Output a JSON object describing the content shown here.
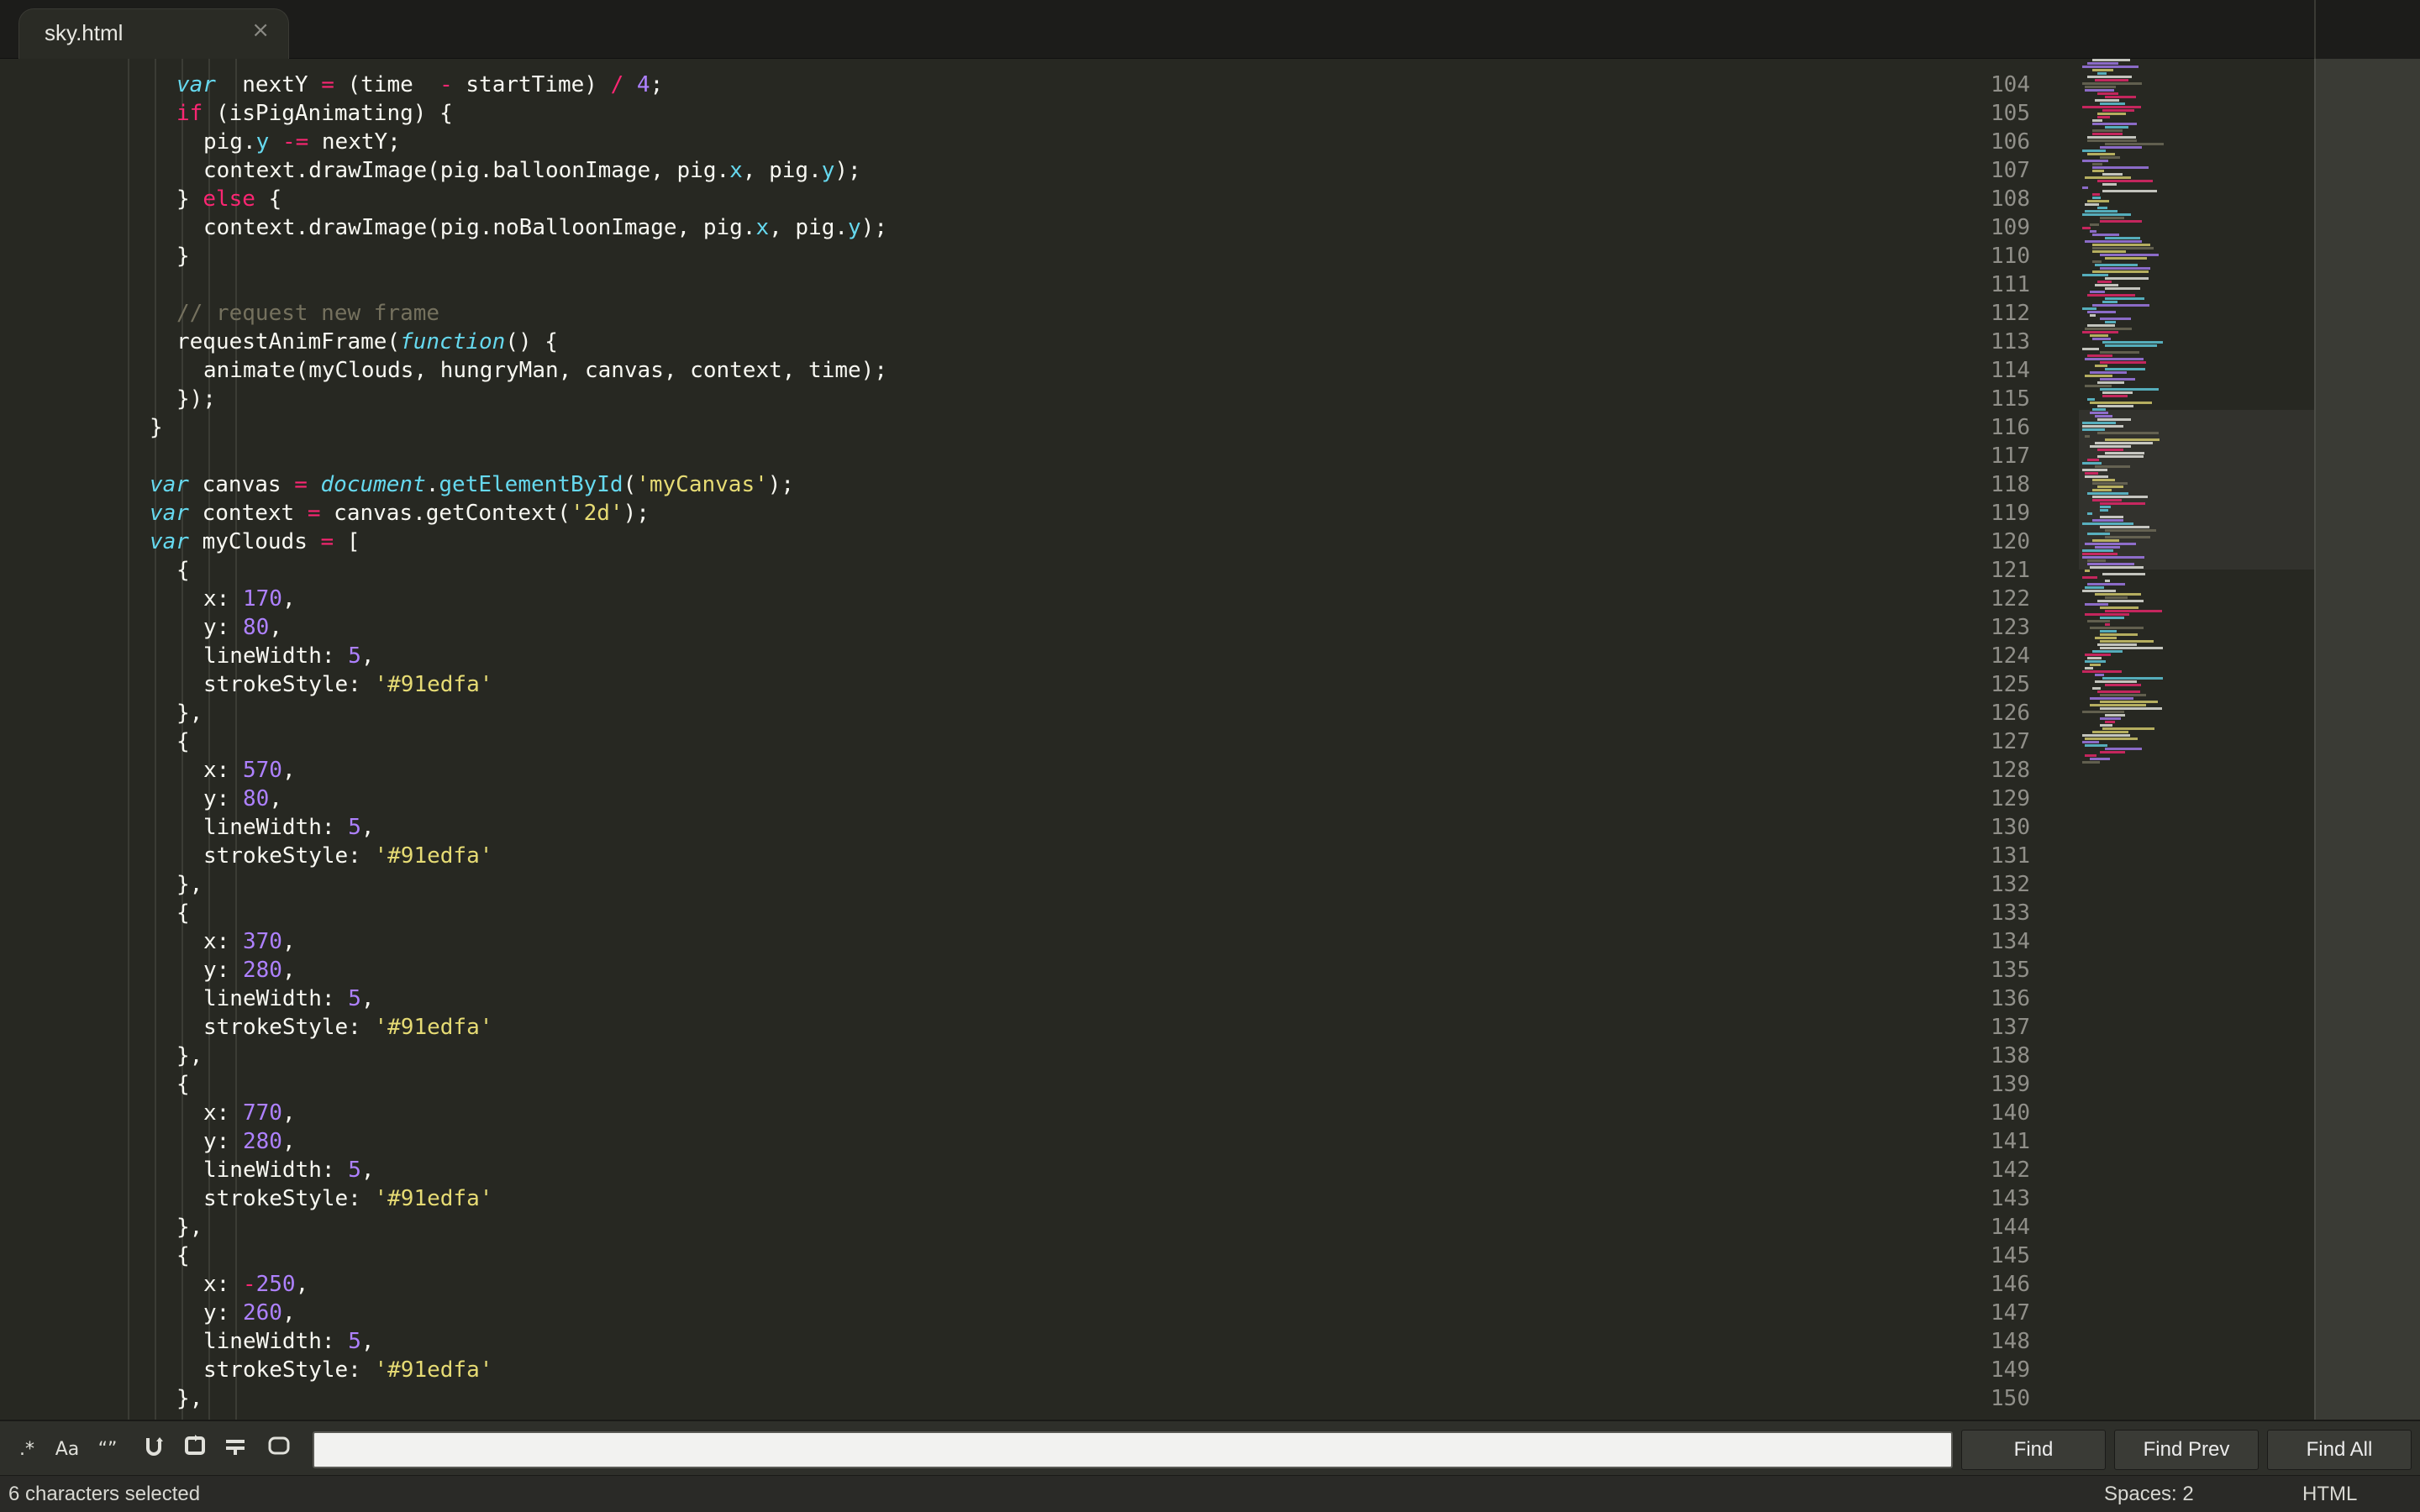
{
  "tab": {
    "title": "sky.html",
    "close": "×"
  },
  "editor": {
    "lines": [
      {
        "n": "104",
        "indent": 4,
        "toks": [
          [
            "st",
            "var"
          ],
          [
            "",
            "  nextY "
          ],
          [
            "kw",
            "="
          ],
          [
            "",
            " (time  "
          ],
          [
            "kw",
            "-"
          ],
          [
            "",
            " startTime) "
          ],
          [
            "kw",
            "/"
          ],
          [
            "",
            " "
          ],
          [
            "nm",
            "4"
          ],
          [
            "",
            ";"
          ]
        ]
      },
      {
        "n": "105",
        "indent": 4,
        "toks": [
          [
            "kw",
            "if"
          ],
          [
            "",
            " (isPigAnimating) {"
          ]
        ]
      },
      {
        "n": "106",
        "indent": 6,
        "toks": [
          [
            "",
            "pig."
          ],
          [
            "pr",
            "y"
          ],
          [
            "",
            " "
          ],
          [
            "kw",
            "-="
          ],
          [
            "",
            " nextY;"
          ]
        ]
      },
      {
        "n": "107",
        "indent": 6,
        "toks": [
          [
            "",
            "context.drawImage(pig.balloonImage, pig."
          ],
          [
            "pr",
            "x"
          ],
          [
            "",
            ", pig."
          ],
          [
            "pr",
            "y"
          ],
          [
            "",
            ");"
          ]
        ]
      },
      {
        "n": "108",
        "indent": 4,
        "toks": [
          [
            "",
            "} "
          ],
          [
            "kw",
            "else"
          ],
          [
            "",
            " {"
          ]
        ]
      },
      {
        "n": "109",
        "indent": 6,
        "toks": [
          [
            "",
            "context.drawImage(pig.noBalloonImage, pig."
          ],
          [
            "pr",
            "x"
          ],
          [
            "",
            ", pig."
          ],
          [
            "pr",
            "y"
          ],
          [
            "",
            ");"
          ]
        ]
      },
      {
        "n": "110",
        "indent": 4,
        "toks": [
          [
            "",
            "}"
          ]
        ]
      },
      {
        "n": "111",
        "indent": 0,
        "toks": []
      },
      {
        "n": "112",
        "indent": 4,
        "toks": [
          [
            "cm",
            "// request new frame"
          ]
        ]
      },
      {
        "n": "113",
        "indent": 4,
        "toks": [
          [
            "",
            "requestAnimFrame("
          ],
          [
            "st",
            "function"
          ],
          [
            "",
            "() {"
          ]
        ]
      },
      {
        "n": "114",
        "indent": 6,
        "toks": [
          [
            "",
            "animate(myClouds, hungryMan, canvas, context, time);"
          ]
        ]
      },
      {
        "n": "115",
        "indent": 4,
        "toks": [
          [
            "",
            "});"
          ]
        ]
      },
      {
        "n": "116",
        "indent": 2,
        "toks": [
          [
            "",
            "}"
          ]
        ]
      },
      {
        "n": "117",
        "indent": 0,
        "toks": []
      },
      {
        "n": "118",
        "indent": 2,
        "toks": [
          [
            "st",
            "var"
          ],
          [
            "",
            " canvas "
          ],
          [
            "kw",
            "="
          ],
          [
            "",
            " "
          ],
          [
            "st",
            "document"
          ],
          [
            "",
            "."
          ],
          [
            "fn",
            "getElementById"
          ],
          [
            "",
            "("
          ],
          [
            "sr",
            "'myCanvas'"
          ],
          [
            "",
            ");"
          ]
        ]
      },
      {
        "n": "119",
        "indent": 2,
        "toks": [
          [
            "st",
            "var"
          ],
          [
            "",
            " context "
          ],
          [
            "kw",
            "="
          ],
          [
            "",
            " canvas.getContext("
          ],
          [
            "sr",
            "'2d'"
          ],
          [
            "",
            ");"
          ]
        ]
      },
      {
        "n": "120",
        "indent": 2,
        "toks": [
          [
            "st",
            "var"
          ],
          [
            "",
            " myClouds "
          ],
          [
            "kw",
            "="
          ],
          [
            "",
            " ["
          ]
        ]
      },
      {
        "n": "121",
        "indent": 4,
        "toks": [
          [
            "",
            "{"
          ]
        ]
      },
      {
        "n": "122",
        "indent": 6,
        "toks": [
          [
            "",
            "x: "
          ],
          [
            "nm",
            "170"
          ],
          [
            "",
            ","
          ]
        ]
      },
      {
        "n": "123",
        "indent": 6,
        "toks": [
          [
            "",
            "y: "
          ],
          [
            "nm",
            "80"
          ],
          [
            "",
            ","
          ]
        ]
      },
      {
        "n": "124",
        "indent": 6,
        "toks": [
          [
            "",
            "lineWidth: "
          ],
          [
            "nm",
            "5"
          ],
          [
            "",
            ","
          ]
        ]
      },
      {
        "n": "125",
        "indent": 6,
        "toks": [
          [
            "",
            "strokeStyle: "
          ],
          [
            "sr",
            "'#91edfa'"
          ]
        ]
      },
      {
        "n": "126",
        "indent": 4,
        "toks": [
          [
            "",
            "},"
          ]
        ]
      },
      {
        "n": "127",
        "indent": 4,
        "toks": [
          [
            "",
            "{"
          ]
        ]
      },
      {
        "n": "128",
        "indent": 6,
        "toks": [
          [
            "",
            "x: "
          ],
          [
            "nm",
            "570"
          ],
          [
            "",
            ","
          ]
        ]
      },
      {
        "n": "129",
        "indent": 6,
        "toks": [
          [
            "",
            "y: "
          ],
          [
            "nm",
            "80"
          ],
          [
            "",
            ","
          ]
        ]
      },
      {
        "n": "130",
        "indent": 6,
        "toks": [
          [
            "",
            "lineWidth: "
          ],
          [
            "nm",
            "5"
          ],
          [
            "",
            ","
          ]
        ]
      },
      {
        "n": "131",
        "indent": 6,
        "toks": [
          [
            "",
            "strokeStyle: "
          ],
          [
            "sr",
            "'#91edfa'"
          ]
        ]
      },
      {
        "n": "132",
        "indent": 4,
        "toks": [
          [
            "",
            "},"
          ]
        ]
      },
      {
        "n": "133",
        "indent": 4,
        "toks": [
          [
            "",
            "{"
          ]
        ]
      },
      {
        "n": "134",
        "indent": 6,
        "toks": [
          [
            "",
            "x: "
          ],
          [
            "nm",
            "370"
          ],
          [
            "",
            ","
          ]
        ]
      },
      {
        "n": "135",
        "indent": 6,
        "toks": [
          [
            "",
            "y: "
          ],
          [
            "nm",
            "280"
          ],
          [
            "",
            ","
          ]
        ]
      },
      {
        "n": "136",
        "indent": 6,
        "toks": [
          [
            "",
            "lineWidth: "
          ],
          [
            "nm",
            "5"
          ],
          [
            "",
            ","
          ]
        ]
      },
      {
        "n": "137",
        "indent": 6,
        "toks": [
          [
            "",
            "strokeStyle: "
          ],
          [
            "sr",
            "'#91edfa'"
          ]
        ]
      },
      {
        "n": "138",
        "indent": 4,
        "toks": [
          [
            "",
            "},"
          ]
        ]
      },
      {
        "n": "139",
        "indent": 4,
        "toks": [
          [
            "",
            "{"
          ]
        ]
      },
      {
        "n": "140",
        "indent": 6,
        "toks": [
          [
            "",
            "x: "
          ],
          [
            "nm",
            "770"
          ],
          [
            "",
            ","
          ]
        ]
      },
      {
        "n": "141",
        "indent": 6,
        "toks": [
          [
            "",
            "y: "
          ],
          [
            "nm",
            "280"
          ],
          [
            "",
            ","
          ]
        ]
      },
      {
        "n": "142",
        "indent": 6,
        "toks": [
          [
            "",
            "lineWidth: "
          ],
          [
            "nm",
            "5"
          ],
          [
            "",
            ","
          ]
        ]
      },
      {
        "n": "143",
        "indent": 6,
        "toks": [
          [
            "",
            "strokeStyle: "
          ],
          [
            "sr",
            "'#91edfa'"
          ]
        ]
      },
      {
        "n": "144",
        "indent": 4,
        "toks": [
          [
            "",
            "},"
          ]
        ]
      },
      {
        "n": "145",
        "indent": 4,
        "toks": [
          [
            "",
            "{"
          ]
        ]
      },
      {
        "n": "146",
        "indent": 6,
        "toks": [
          [
            "",
            "x: "
          ],
          [
            "kw",
            "-"
          ],
          [
            "nm",
            "250"
          ],
          [
            "",
            ","
          ]
        ]
      },
      {
        "n": "147",
        "indent": 6,
        "toks": [
          [
            "",
            "y: "
          ],
          [
            "nm",
            "260"
          ],
          [
            "",
            ","
          ]
        ]
      },
      {
        "n": "148",
        "indent": 6,
        "toks": [
          [
            "",
            "lineWidth: "
          ],
          [
            "nm",
            "5"
          ],
          [
            "",
            ","
          ]
        ]
      },
      {
        "n": "149",
        "indent": 6,
        "toks": [
          [
            "",
            "strokeStyle: "
          ],
          [
            "sr",
            "'#91edfa'"
          ]
        ]
      },
      {
        "n": "150",
        "indent": 4,
        "toks": [
          [
            "",
            "},"
          ]
        ]
      }
    ]
  },
  "find": {
    "regex_icon": "regex-icon",
    "case_icon": "case-sensitive-icon",
    "case_label": "Aa",
    "word_label": "“”",
    "word_icon": "whole-word-icon",
    "wrap_icon": "wrap-icon",
    "in_selection_icon": "in-selection-icon",
    "highlight_icon": "highlight-matches-icon",
    "toggle_icon": "toggle-icon",
    "input_value": "",
    "find_label": "Find",
    "find_prev_label": "Find Prev",
    "find_all_label": "Find All"
  },
  "status": {
    "selection": "6 characters selected",
    "spaces": "Spaces: 2",
    "syntax": "HTML"
  },
  "colors": {
    "background": "#272822",
    "keyword": "#f92672",
    "storage": "#66d9ef",
    "number": "#ae81ff",
    "string": "#e6db74",
    "comment": "#75715e",
    "foreground": "#f8f8f2"
  }
}
